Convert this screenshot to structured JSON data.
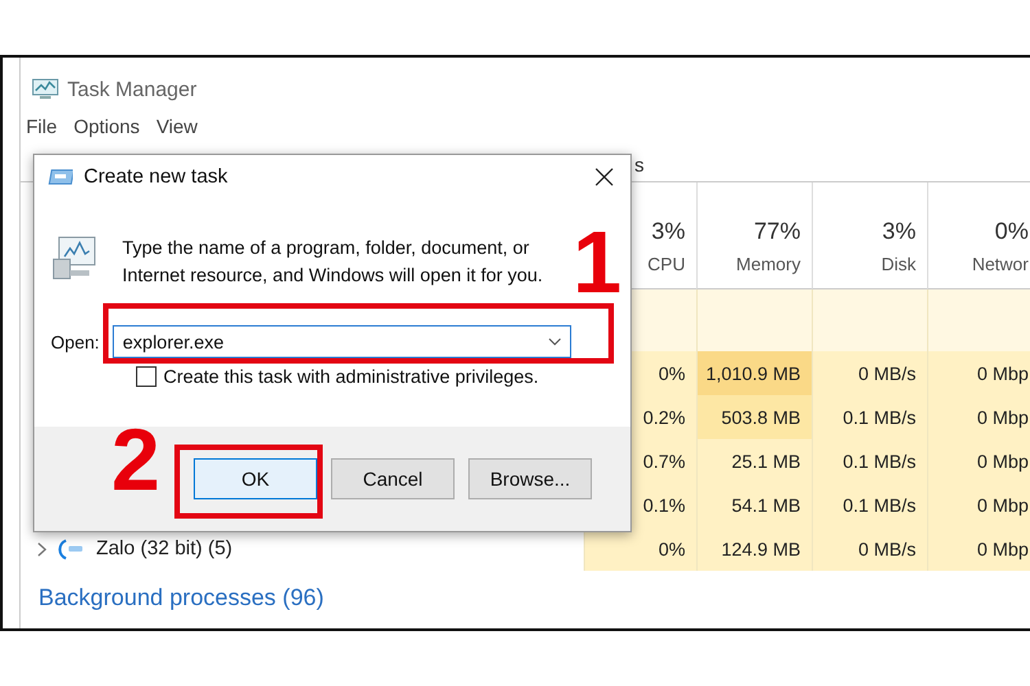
{
  "window": {
    "title": "Task Manager"
  },
  "menu": [
    "File",
    "Options",
    "View"
  ],
  "tabs": [
    {
      "label": "s",
      "selected": false
    }
  ],
  "columns": [
    {
      "percent": "3%",
      "label": "CPU"
    },
    {
      "percent": "77%",
      "label": "Memory"
    },
    {
      "percent": "3%",
      "label": "Disk"
    },
    {
      "percent": "0%",
      "label": "Networ"
    }
  ],
  "processes": [
    {
      "cells": [
        {
          "text": "0%",
          "color": "#fff1c4"
        },
        {
          "text": "1,010.9 MB",
          "color": "#fad987"
        },
        {
          "text": "0 MB/s",
          "color": "#fff1c4"
        },
        {
          "text": "0 Mbp",
          "color": "#fff1c4"
        }
      ]
    },
    {
      "cells": [
        {
          "text": "0.2%",
          "color": "#fff1c4"
        },
        {
          "text": "503.8 MB",
          "color": "#fde7a4"
        },
        {
          "text": "0.1 MB/s",
          "color": "#fff1c4"
        },
        {
          "text": "0 Mbp",
          "color": "#fff1c4"
        }
      ]
    },
    {
      "cells": [
        {
          "text": "0.7%",
          "color": "#fff1c4"
        },
        {
          "text": "25.1 MB",
          "color": "#fff1c4"
        },
        {
          "text": "0.1 MB/s",
          "color": "#fff1c4"
        },
        {
          "text": "0 Mbp",
          "color": "#fff1c4"
        }
      ]
    },
    {
      "cells": [
        {
          "text": "0.1%",
          "color": "#fff1c4"
        },
        {
          "text": "54.1 MB",
          "color": "#fff1c4"
        },
        {
          "text": "0.1 MB/s",
          "color": "#fff1c4"
        },
        {
          "text": "0 Mbp",
          "color": "#fff1c4"
        }
      ]
    },
    {
      "name": "Zalo (32 bit) (5)",
      "cells": [
        {
          "text": "0%",
          "color": "#fff1c4"
        },
        {
          "text": "124.9 MB",
          "color": "#fff1c4"
        },
        {
          "text": "0 MB/s",
          "color": "#fff1c4"
        },
        {
          "text": "0 Mbp",
          "color": "#fff1c4"
        }
      ]
    }
  ],
  "background_group": "Background processes (96)",
  "dialog": {
    "title": "Create new task",
    "message": "Type the name of a program, folder, document, or Internet resource, and Windows will open it for you.",
    "open_label": "Open:",
    "open_value": "explorer.exe",
    "admin_checkbox": {
      "label": "Create this task with administrative privileges.",
      "checked": false
    },
    "buttons": [
      {
        "label": "OK",
        "default": true
      },
      {
        "label": "Cancel",
        "default": false
      },
      {
        "label": "Browse...",
        "default": false
      }
    ]
  },
  "annotations": [
    {
      "number": "1"
    },
    {
      "number": "2"
    }
  ]
}
